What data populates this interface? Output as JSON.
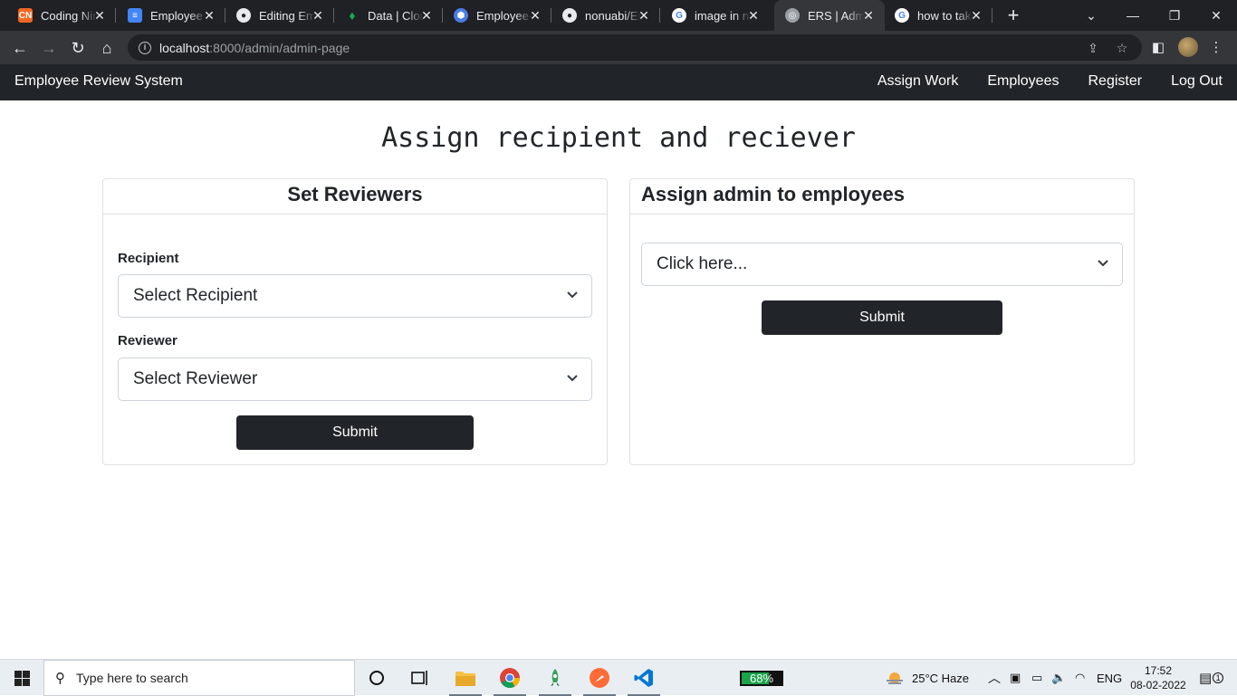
{
  "browser": {
    "tabs": [
      {
        "title": "Coding Ninjas",
        "icon": "coding-ninjas-icon",
        "color": "#f26722"
      },
      {
        "title": "Employee Review",
        "icon": "google-docs-icon",
        "color": "#4285f4"
      },
      {
        "title": "Editing Employee",
        "icon": "github-icon",
        "color": "#202124"
      },
      {
        "title": "Data | Cloud",
        "icon": "mongodb-icon",
        "color": "#13aa52"
      },
      {
        "title": "Employee-review",
        "icon": "heroku-icon",
        "color": "#4a7be6"
      },
      {
        "title": "nonuabi/Employee",
        "icon": "github-icon",
        "color": "#202124"
      },
      {
        "title": "image in node",
        "icon": "google-icon",
        "color": "#ffffff"
      },
      {
        "title": "ERS | Admin",
        "icon": "globe-icon",
        "color": "#9aa0a6",
        "active": true
      },
      {
        "title": "how to take",
        "icon": "google-icon",
        "color": "#ffffff"
      }
    ],
    "url_host": "localhost",
    "url_path": ":8000/admin/admin-page"
  },
  "navbar": {
    "brand": "Employee Review System",
    "links": [
      "Assign Work",
      "Employees",
      "Register",
      "Log Out"
    ]
  },
  "page": {
    "heading": "Assign recipient and reciever"
  },
  "reviewers_card": {
    "title": "Set Reviewers",
    "recipient_label": "Recipient",
    "recipient_value": "Select Recipient",
    "reviewer_label": "Reviewer",
    "reviewer_value": "Select Reviewer",
    "submit_label": "Submit"
  },
  "admin_card": {
    "title": "Assign admin to employees",
    "select_value": "Click here...",
    "submit_label": "Submit"
  },
  "taskbar": {
    "search_placeholder": "Type here to search",
    "battery_label": "68%",
    "battery_level": 0.68,
    "weather": "25°C  Haze",
    "language": "ENG",
    "time": "17:52",
    "date": "08-02-2022",
    "notifications": "1"
  }
}
